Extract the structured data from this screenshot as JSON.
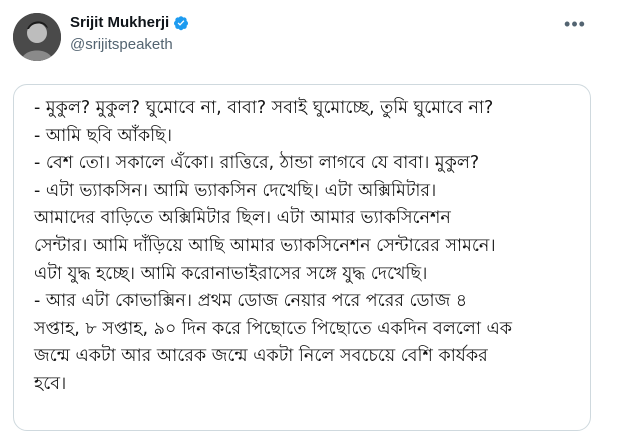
{
  "tweet": {
    "author_name": "Srijit Mukherji",
    "author_handle": "@srijitspeaketh",
    "more_label": "•••",
    "avatar_icon": "user-avatar-photo",
    "verified_icon": "verified-badge-icon",
    "accent_color": "#1d9bf0"
  },
  "media": {
    "lines": [
      "- মুকুল? মুকুল? ঘুমোবে না, বাবা? সবাই ঘুমোচ্ছে, তুমি ঘুমোবে না?",
      "- আমি ছবি আঁকছি।",
      "- বেশ তো। সকালে এঁকো। রাত্তিরে, ঠান্ডা লাগবে যে বাবা। মুকুল?",
      "- এটা ভ্যাকসিন। আমি ভ্যাকসিন দেখেছি। এটা অক্সিমিটার।",
      "আমাদের বাড়িতে অক্সিমিটার ছিল। এটা আমার ভ্যাকসিনেশন",
      "সেন্টার। আমি দাঁড়িয়ে আছি আমার ভ্যাকসিনেশন সেন্টারের সামনে।",
      "এটা যুদ্ধ হচ্ছে। আমি করোনাভাইরাসের সঙ্গে যুদ্ধ দেখেছি।",
      "- আর এটা কোভাক্সিন। প্রথম ডোজ নেয়ার পরে পরের ডোজ ৪",
      "সপ্তাহ, ৮ সপ্তাহ, ৯০ দিন করে পিছোতে পিছোতে একদিন বললো এক",
      "জন্মে একটা আর আরেক জন্মে একটা নিলে সবচেয়ে বেশি কার্যকর",
      "হবে।"
    ]
  }
}
